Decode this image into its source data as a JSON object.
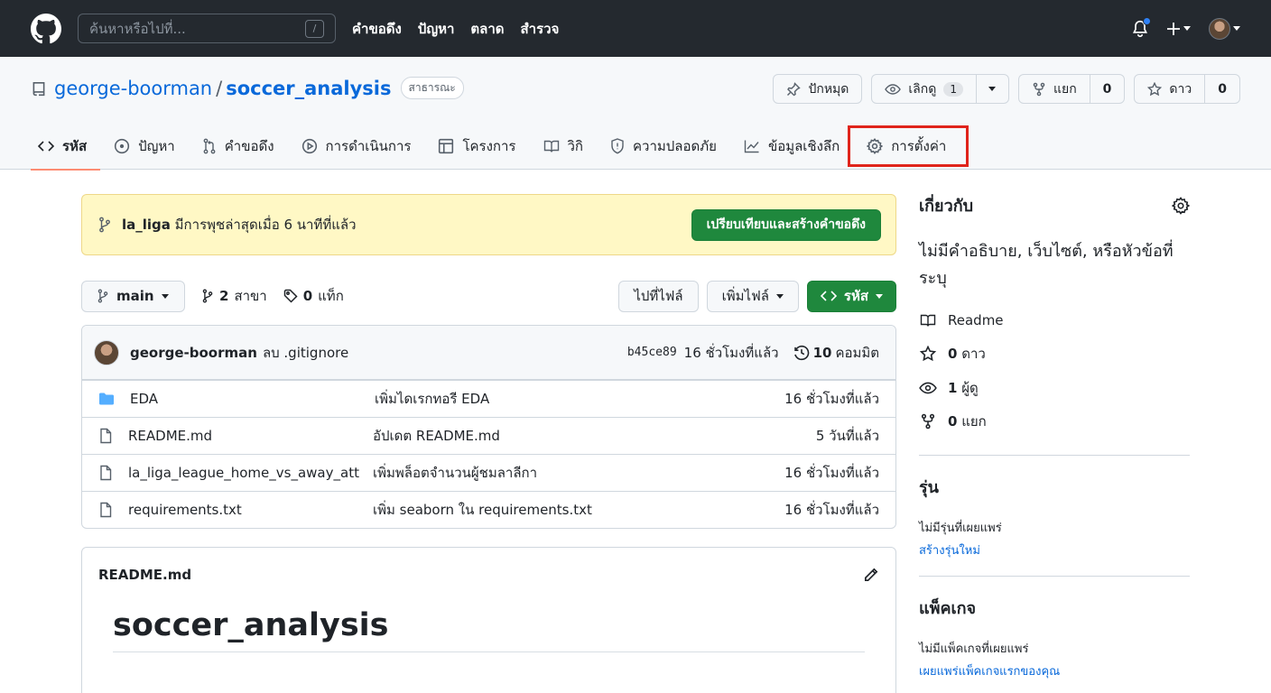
{
  "header": {
    "search_placeholder": "ค้นหาหรือไปที่...",
    "search_shortcut": "/",
    "nav": [
      "คำขอดึง",
      "ปัญหา",
      "ตลาด",
      "สำรวจ"
    ]
  },
  "repo": {
    "owner": "george-boorman",
    "separator": "/",
    "name": "soccer_analysis",
    "visibility": "สาธารณะ",
    "pin_label": "ปักหมุด",
    "watch_label": "เลิกดู",
    "watch_count": "1",
    "fork_label": "แยก",
    "fork_count": "0",
    "star_label": "ดาว",
    "star_count": "0"
  },
  "tabs": [
    {
      "label": "รหัส",
      "icon": "code-icon"
    },
    {
      "label": "ปัญหา",
      "icon": "issue-icon"
    },
    {
      "label": "คำขอดึง",
      "icon": "pull-request-icon"
    },
    {
      "label": "การดำเนินการ",
      "icon": "play-icon"
    },
    {
      "label": "โครงการ",
      "icon": "table-icon"
    },
    {
      "label": "วิกิ",
      "icon": "book-icon"
    },
    {
      "label": "ความปลอดภัย",
      "icon": "shield-icon"
    },
    {
      "label": "ข้อมูลเชิงลึก",
      "icon": "graph-icon"
    },
    {
      "label": "การตั้งค่า",
      "icon": "gear-icon"
    }
  ],
  "banner": {
    "branch": "la_liga",
    "text": " มีการพุชล่าสุดเมื่อ 6 นาทีที่แล้ว",
    "button": "เปรียบเทียบและสร้างคำขอดึง"
  },
  "filebar": {
    "branch": "main",
    "branches_count": "2",
    "branches_label": "สาขา",
    "tags_count": "0",
    "tags_label": "แท็ก",
    "goto_file": "ไปที่ไฟล์",
    "add_file": "เพิ่มไฟล์",
    "code": "รหัส"
  },
  "commit": {
    "author": "george-boorman",
    "message": "ลบ .gitignore",
    "sha": "b45ce89",
    "time": "16 ชั่วโมงที่แล้ว",
    "commits_count": "10",
    "commits_label": "คอมมิต"
  },
  "files": [
    {
      "name": "EDA",
      "type": "folder",
      "message": "เพิ่มไดเรกทอรี EDA",
      "time": "16 ชั่วโมงที่แล้ว"
    },
    {
      "name": "README.md",
      "type": "file",
      "message": "อัปเดต README.md",
      "time": "5 วันที่แล้ว"
    },
    {
      "name": "la_liga_league_home_vs_away_att...",
      "type": "file",
      "message": "เพิ่มพล็อตจำนวนผู้ชมลาลีกา",
      "time": "16 ชั่วโมงที่แล้ว"
    },
    {
      "name": "requirements.txt",
      "type": "file",
      "message": "เพิ่ม seaborn ใน requirements.txt",
      "time": "16 ชั่วโมงที่แล้ว"
    }
  ],
  "readme": {
    "filename": "README.md",
    "heading": "soccer_analysis"
  },
  "sidebar": {
    "about_title": "เกี่ยวกับ",
    "about_desc": "ไม่มีคำอธิบาย, เว็บไซต์, หรือหัวข้อที่ระบุ",
    "readme_label": "Readme",
    "stars_count": "0",
    "stars_label": "ดาว",
    "watchers_count": "1",
    "watchers_label": "ผู้ดู",
    "forks_count": "0",
    "forks_label": "แยก",
    "releases_title": "รุ่น",
    "releases_none": "ไม่มีรุ่นที่เผยแพร่",
    "releases_link": "สร้างรุ่นใหม่",
    "packages_title": "แพ็คเกจ",
    "packages_none": "ไม่มีแพ็คเกจที่เผยแพร่",
    "packages_link": "เผยแพร่แพ็คเกจแรกของคุณ"
  },
  "colors": {
    "header_bg": "#24292f",
    "accent_link": "#0969da",
    "green_button": "#1f883d",
    "selected_tab_underline": "#fd8c73",
    "highlight_box": "#e0241b",
    "banner_bg": "#fff8c5",
    "notification_dot": "#2f81f7"
  }
}
